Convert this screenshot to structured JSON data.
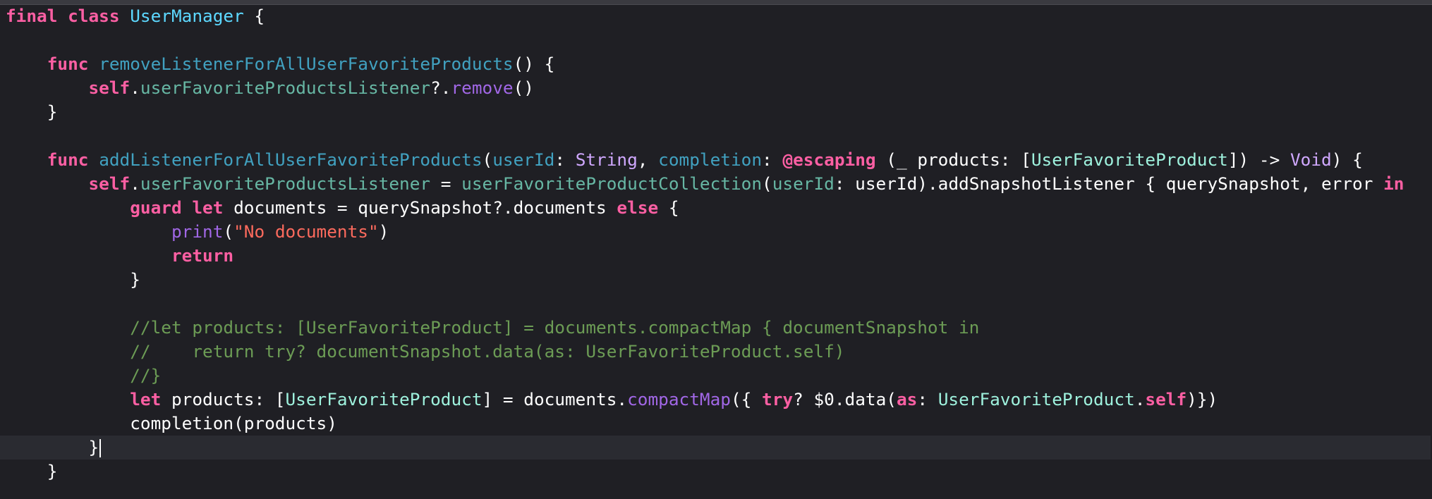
{
  "editor": {
    "lines": [
      [
        {
          "t": "final class ",
          "c": "kw"
        },
        {
          "t": "UserManager",
          "c": "tdecl"
        },
        {
          "t": " {"
        }
      ],
      [],
      [
        {
          "t": "    "
        },
        {
          "t": "func",
          "c": "kw"
        },
        {
          "t": " "
        },
        {
          "t": "removeListenerForAllUserFavoriteProducts",
          "c": "fdecl"
        },
        {
          "t": "() {"
        }
      ],
      [
        {
          "t": "        "
        },
        {
          "t": "self",
          "c": "kw"
        },
        {
          "t": "."
        },
        {
          "t": "userFavoriteProductsListener",
          "c": "prm"
        },
        {
          "t": "?."
        },
        {
          "t": "remove",
          "c": "fcall"
        },
        {
          "t": "()"
        }
      ],
      [
        {
          "t": "    }"
        }
      ],
      [],
      [
        {
          "t": "    "
        },
        {
          "t": "func",
          "c": "kw"
        },
        {
          "t": " "
        },
        {
          "t": "addListenerForAllUserFavoriteProducts",
          "c": "fdecl"
        },
        {
          "t": "("
        },
        {
          "t": "userId",
          "c": "fdecl"
        },
        {
          "t": ": "
        },
        {
          "t": "String",
          "c": "stype"
        },
        {
          "t": ", "
        },
        {
          "t": "completion",
          "c": "fdecl"
        },
        {
          "t": ": "
        },
        {
          "t": "@escaping",
          "c": "kw"
        },
        {
          "t": " (_ products: ["
        },
        {
          "t": "UserFavoriteProduct",
          "c": "tref"
        },
        {
          "t": "]) -> "
        },
        {
          "t": "Void",
          "c": "stype"
        },
        {
          "t": ") {"
        }
      ],
      [
        {
          "t": "        "
        },
        {
          "t": "self",
          "c": "kw"
        },
        {
          "t": "."
        },
        {
          "t": "userFavoriteProductsListener",
          "c": "prm"
        },
        {
          "t": " = "
        },
        {
          "t": "userFavoriteProductCollection",
          "c": "prm"
        },
        {
          "t": "("
        },
        {
          "t": "userId",
          "c": "prm"
        },
        {
          "t": ": userId).addSnapshotListener { querySnapshot, error "
        },
        {
          "t": "in",
          "c": "kw"
        }
      ],
      [
        {
          "t": "            "
        },
        {
          "t": "guard",
          "c": "kw"
        },
        {
          "t": " "
        },
        {
          "t": "let",
          "c": "kw"
        },
        {
          "t": " documents = querySnapshot?.documents "
        },
        {
          "t": "else",
          "c": "kw"
        },
        {
          "t": " {"
        }
      ],
      [
        {
          "t": "                "
        },
        {
          "t": "print",
          "c": "fcall"
        },
        {
          "t": "("
        },
        {
          "t": "\"No documents\"",
          "c": "str"
        },
        {
          "t": ")"
        }
      ],
      [
        {
          "t": "                "
        },
        {
          "t": "return",
          "c": "kw"
        }
      ],
      [
        {
          "t": "            }"
        }
      ],
      [],
      [
        {
          "t": "            "
        },
        {
          "t": "//let products: [UserFavoriteProduct] = documents.compactMap { documentSnapshot in",
          "c": "cmt"
        }
      ],
      [
        {
          "t": "            "
        },
        {
          "t": "//    return try? documentSnapshot.data(as: UserFavoriteProduct.self)",
          "c": "cmt"
        }
      ],
      [
        {
          "t": "            "
        },
        {
          "t": "//}",
          "c": "cmt"
        }
      ],
      [
        {
          "t": "            "
        },
        {
          "t": "let",
          "c": "kw"
        },
        {
          "t": " products: ["
        },
        {
          "t": "UserFavoriteProduct",
          "c": "tref"
        },
        {
          "t": "] = documents."
        },
        {
          "t": "compactMap",
          "c": "fcall"
        },
        {
          "t": "({ "
        },
        {
          "t": "try",
          "c": "kw"
        },
        {
          "t": "? $0.data("
        },
        {
          "t": "as",
          "c": "kw"
        },
        {
          "t": ": "
        },
        {
          "t": "UserFavoriteProduct",
          "c": "tref"
        },
        {
          "t": "."
        },
        {
          "t": "self",
          "c": "kw"
        },
        {
          "t": ")})"
        }
      ],
      [
        {
          "t": "            completion(products)"
        }
      ],
      [
        {
          "t": "        }"
        }
      ],
      [
        {
          "t": "    }"
        }
      ]
    ],
    "current_line": 18,
    "colors": {
      "background": "#1f1f24",
      "current_line": "#2a2b31",
      "keyword": "#fc5fa3",
      "type_declaration": "#5dd8ff",
      "function_declaration": "#41a1c0",
      "type_reference": "#9ef1dd",
      "system_type": "#d0a8ff",
      "property": "#67b7a4",
      "function_call": "#a167e6",
      "string": "#fc6a5d",
      "comment": "#6c9c55",
      "plain": "#ffffff"
    }
  }
}
